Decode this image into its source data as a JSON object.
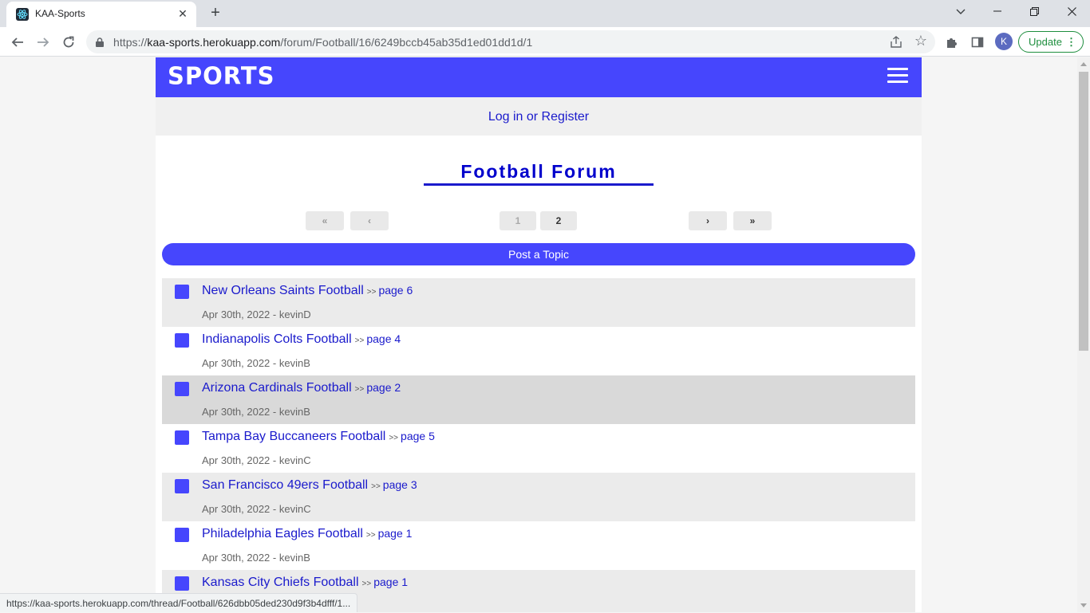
{
  "browser": {
    "tab_title": "KAA-Sports",
    "tab_close": "✕",
    "new_tab": "+",
    "url_scheme": "https://",
    "url_host": "kaa-sports.herokuapp.com",
    "url_path": "/forum/Football/16/6249bccb45ab35d1ed01dd1d/1",
    "profile_initial": "K",
    "update_label": "Update",
    "status_url": "https://kaa-sports.herokuapp.com/thread/Football/626dbb05ded230d9f3b4dfff/1..."
  },
  "site": {
    "logo": "SPORTS",
    "brand_color": "#4646fd",
    "login_link": "Log in or Register",
    "forum_title": "Football Forum",
    "pagination": {
      "first": "«",
      "prev": "‹",
      "pages": [
        "1",
        "2"
      ],
      "next": "›",
      "last": "»"
    },
    "post_topic": "Post a Topic",
    "topics": [
      {
        "title": "New Orleans Saints Football",
        "sep": ">>",
        "page": "page 6",
        "meta": "Apr 30th, 2022 - kevinD"
      },
      {
        "title": "Indianapolis Colts Football",
        "sep": ">>",
        "page": "page 4",
        "meta": "Apr 30th, 2022 - kevinB"
      },
      {
        "title": "Arizona Cardinals Football",
        "sep": ">>",
        "page": "page 2",
        "meta": "Apr 30th, 2022 - kevinB"
      },
      {
        "title": "Tampa Bay Buccaneers Football",
        "sep": ">>",
        "page": "page 5",
        "meta": "Apr 30th, 2022 - kevinC"
      },
      {
        "title": "San Francisco 49ers Football",
        "sep": ">>",
        "page": "page 3",
        "meta": "Apr 30th, 2022 - kevinC"
      },
      {
        "title": "Philadelphia Eagles Football",
        "sep": ">>",
        "page": "page 1",
        "meta": "Apr 30th, 2022 - kevinB"
      },
      {
        "title": "Kansas City Chiefs Football",
        "sep": ">>",
        "page": "page 1",
        "meta": ""
      }
    ]
  }
}
